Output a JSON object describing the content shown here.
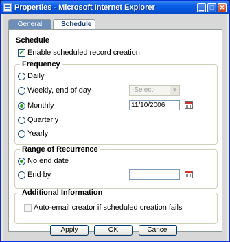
{
  "window": {
    "title": "Properties - Microsoft Internet Explorer"
  },
  "tabs": [
    {
      "label": "General"
    },
    {
      "label": "Schedule"
    }
  ],
  "schedule": {
    "section_title": "Schedule",
    "enable_label": "Enable scheduled record creation",
    "enable_checked": true
  },
  "frequency": {
    "legend": "Frequency",
    "options": [
      {
        "label": "Daily",
        "checked": false
      },
      {
        "label": "Weekly, end of day",
        "checked": false
      },
      {
        "label": "Monthly",
        "checked": true
      },
      {
        "label": "Quarterly",
        "checked": false
      },
      {
        "label": "Yearly",
        "checked": false
      }
    ],
    "weekly_select_value": "-Select-",
    "monthly_date": "11/10/2006"
  },
  "recurrence": {
    "legend": "Range of Recurrence",
    "options": [
      {
        "label": "No end date",
        "checked": true
      },
      {
        "label": "End by",
        "checked": false
      }
    ],
    "end_by_date": ""
  },
  "additional": {
    "legend": "Additional Information",
    "auto_email_label": "Auto-email creator if scheduled creation fails",
    "auto_email_checked": false
  },
  "buttons": {
    "apply": "Apply",
    "ok": "OK",
    "cancel": "Cancel"
  },
  "icons": {
    "title": "ie-page-icon",
    "minimize": "minimize-icon",
    "maximize": "maximize-icon",
    "close": "close-icon",
    "calendar": "calendar-icon"
  }
}
